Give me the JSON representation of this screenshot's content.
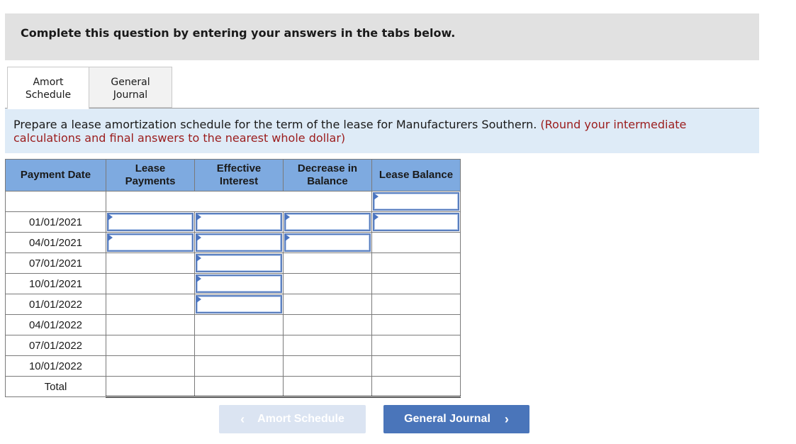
{
  "instruction": "Complete this question by entering your answers in the tabs below.",
  "tabs": [
    {
      "line1": "Amort",
      "line2": "Schedule",
      "active": true
    },
    {
      "line1": "General",
      "line2": "Journal",
      "active": false
    }
  ],
  "prompt": {
    "text": "Prepare a lease amortization schedule for the term of the lease for Manufacturers Southern.",
    "note": "(Round your intermediate calculations and final answers to the nearest whole dollar)"
  },
  "table": {
    "headers": {
      "payment_date": "Payment Date",
      "lease_payments": [
        "Lease",
        "Payments"
      ],
      "effective_interest": [
        "Effective",
        "Interest"
      ],
      "decrease_in_balance": [
        "Decrease in",
        "Balance"
      ],
      "lease_balance": "Lease Balance"
    },
    "rows": [
      {
        "date": "",
        "lease_payments": "",
        "effective_interest": "",
        "decrease_in_balance": "",
        "lease_balance": ""
      },
      {
        "date": "01/01/2021",
        "lease_payments": "",
        "effective_interest": "",
        "decrease_in_balance": "",
        "lease_balance": ""
      },
      {
        "date": "04/01/2021",
        "lease_payments": "",
        "effective_interest": "",
        "decrease_in_balance": ""
      },
      {
        "date": "07/01/2021",
        "effective_interest": ""
      },
      {
        "date": "10/01/2021",
        "effective_interest": ""
      },
      {
        "date": "01/01/2022",
        "effective_interest": ""
      },
      {
        "date": "04/01/2022"
      },
      {
        "date": "07/01/2022"
      },
      {
        "date": "10/01/2022"
      }
    ],
    "total_label": "Total"
  },
  "nav": {
    "prev_label": "Amort Schedule",
    "next_label": "General Journal",
    "prev_icon": "chevron-left-icon",
    "next_icon": "chevron-right-icon"
  },
  "colors": {
    "header_bg": "#7eaae0",
    "prompt_bg": "#deebf7",
    "note_red": "#9b1c1c",
    "button_primary": "#4a75ba",
    "button_disabled": "#dbe4f2",
    "input_border": "#5b7fbe"
  }
}
